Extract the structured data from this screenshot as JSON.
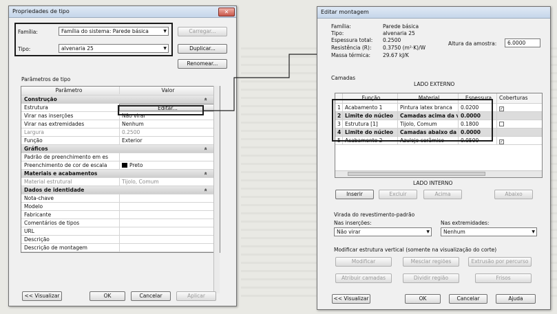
{
  "type_props": {
    "title": "Propriedades de tipo",
    "close": "✕",
    "family_label": "Família:",
    "family_value": "Família do sistema: Parede básica",
    "type_label": "Tipo:",
    "type_value": "alvenaria 25",
    "load_button": "Carregar...",
    "duplicate_button": "Duplicar...",
    "rename_button": "Renomear...",
    "params_label": "Parâmetros de tipo",
    "col_param": "Parâmetro",
    "col_value": "Valor",
    "rows": [
      {
        "param": "Construção",
        "value": "",
        "group": true
      },
      {
        "param": "Estrutura",
        "value": "Editar..."
      },
      {
        "param": "Virar nas inserções",
        "value": "Não virar"
      },
      {
        "param": "Virar nas extremidades",
        "value": "Nenhum"
      },
      {
        "param": "Largura",
        "value": "0.2500",
        "dim": true
      },
      {
        "param": "Função",
        "value": "Exterior"
      },
      {
        "param": "Gráficos",
        "value": "",
        "group": true
      },
      {
        "param": "Padrão de preenchimento em es",
        "value": ""
      },
      {
        "param": "Preenchimento de cor de escala",
        "value": "Preto"
      },
      {
        "param": "Materiais e acabamentos",
        "value": "",
        "group": true
      },
      {
        "param": "Material estrutural",
        "value": "Tijolo, Comum",
        "dim": true
      },
      {
        "param": "Dados de identidade",
        "value": "",
        "group": true
      },
      {
        "param": "Nota-chave",
        "value": ""
      },
      {
        "param": "Modelo",
        "value": ""
      },
      {
        "param": "Fabricante",
        "value": ""
      },
      {
        "param": "Comentários de tipos",
        "value": ""
      },
      {
        "param": "URL",
        "value": ""
      },
      {
        "param": "Descrição",
        "value": ""
      },
      {
        "param": "Descrição de montagem",
        "value": ""
      }
    ],
    "preview_button": "<< Visualizar",
    "ok_button": "OK",
    "cancel_button": "Cancelar",
    "apply_button": "Aplicar"
  },
  "edit_assembly": {
    "title": "Editar montagem",
    "family_label": "Família:",
    "family_value": "Parede básica",
    "type_label": "Tipo:",
    "type_value": "alvenaria 25",
    "thickness_label": "Espessura total:",
    "thickness_value": "0.2500",
    "resistance_label": "Resistência (R):",
    "resistance_value": "0.3750 (m²·K)/W",
    "mass_label": "Massa térmica:",
    "mass_value": "29.67 kJ/K",
    "sample_height_label": "Altura da amostra:",
    "sample_height_value": "6.0000",
    "layers_label": "Camadas",
    "exterior_side": "LADO EXTERNO",
    "interior_side": "LADO INTERNO",
    "col_function": "Função",
    "col_material": "Material",
    "col_thickness": "Espessura",
    "col_wraps": "Coberturas",
    "layers": [
      {
        "num": "1",
        "function": "Acabamento 1",
        "material": "Pintura latex branca",
        "thickness": "0.0200",
        "wrap": true,
        "hl": false
      },
      {
        "num": "2",
        "function": "Limite do núcleo",
        "material": "Camadas acima da vir",
        "thickness": "0.0000",
        "wrap": false,
        "hl": true
      },
      {
        "num": "3",
        "function": "Estrutura [1]",
        "material": "Tijolo, Comum",
        "thickness": "0.1800",
        "wrap": false,
        "hl": false
      },
      {
        "num": "4",
        "function": "Limite do núcleo",
        "material": "Camadas abaixo da vi",
        "thickness": "0.0000",
        "wrap": false,
        "hl": true
      },
      {
        "num": "5",
        "function": "Acabamento 2",
        "material": "Azulejo cerâmico",
        "thickness": "0.0500",
        "wrap": true,
        "hl": false
      }
    ],
    "insert_button": "Inserir",
    "delete_button": "Excluir",
    "up_button": "Acima",
    "down_button": "Abaixo",
    "wrap_label": "Virada do revestimento-padrão",
    "at_inserts_label": "Nas inserções:",
    "at_inserts_value": "Não virar",
    "at_ends_label": "Nas extremidades:",
    "at_ends_value": "Nenhum",
    "vertical_label": "Modificar estrutura vertical (somente na visualização do corte)",
    "modify_button": "Modificar",
    "merge_button": "Mesclar regiões",
    "sweeps_button": "Extrusão por percurso",
    "assign_button": "Atribuir camadas",
    "split_button": "Dividir região",
    "reveals_button": "Frisos",
    "preview_button": "<< Visualizar",
    "ok_button": "OK",
    "cancel_button": "Cancelar",
    "help_button": "Ajuda"
  }
}
